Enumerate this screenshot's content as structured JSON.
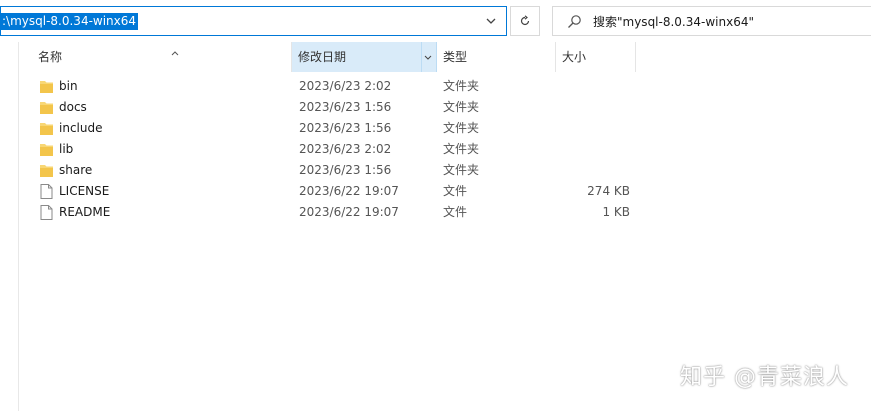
{
  "address": {
    "path": ":\\mysql-8.0.34-winx64"
  },
  "search": {
    "placeholder": "搜索\"mysql-8.0.34-winx64\""
  },
  "columns": [
    {
      "label": "名称"
    },
    {
      "label": "修改日期"
    },
    {
      "label": "类型"
    },
    {
      "label": "大小"
    }
  ],
  "files": [
    {
      "name": "bin",
      "date": "2023/6/23 2:02",
      "type": "文件夹",
      "size": "",
      "icon": "folder-icon"
    },
    {
      "name": "docs",
      "date": "2023/6/23 1:56",
      "type": "文件夹",
      "size": "",
      "icon": "folder-icon"
    },
    {
      "name": "include",
      "date": "2023/6/23 1:56",
      "type": "文件夹",
      "size": "",
      "icon": "folder-icon"
    },
    {
      "name": "lib",
      "date": "2023/6/23 2:02",
      "type": "文件夹",
      "size": "",
      "icon": "folder-icon"
    },
    {
      "name": "share",
      "date": "2023/6/23 1:56",
      "type": "文件夹",
      "size": "",
      "icon": "folder-icon"
    },
    {
      "name": "LICENSE",
      "date": "2023/6/22 19:07",
      "type": "文件",
      "size": "274 KB",
      "icon": "file-icon"
    },
    {
      "name": "README",
      "date": "2023/6/22 19:07",
      "type": "文件",
      "size": "1 KB",
      "icon": "file-icon"
    }
  ],
  "watermark": "知乎 @青菜浪人",
  "colors": {
    "accent": "#0078d7",
    "folder": "#f8d775",
    "header_active": "#d9ebf9"
  }
}
